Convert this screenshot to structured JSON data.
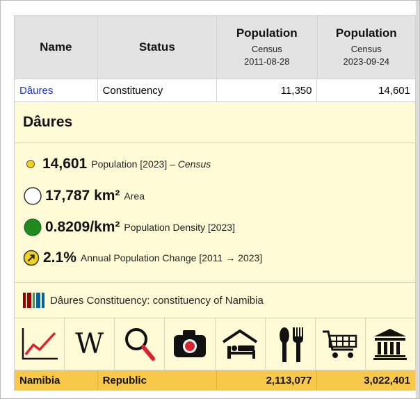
{
  "header": {
    "name": "Name",
    "status": "Status",
    "col3_title": "Population",
    "col3_sub1": "Census",
    "col3_sub2": "2011-08-28",
    "col4_title": "Population",
    "col4_sub1": "Census",
    "col4_sub2": "2023-09-24"
  },
  "row": {
    "name": "Dâures",
    "status": "Constituency",
    "pop2011": "11,350",
    "pop2023": "14,601"
  },
  "panel": {
    "title": "Dâures",
    "stats": [
      {
        "value": "14,601",
        "label": "Population [2023] –",
        "label_italic": "Census"
      },
      {
        "value": "17,787 km²",
        "label": "Area",
        "label_italic": ""
      },
      {
        "value": "0.8209/km²",
        "label": "Population Density [2023]",
        "label_italic": ""
      },
      {
        "value": "2.1%",
        "label": "Annual Population Change [2011 → 2023]",
        "label_italic": ""
      }
    ],
    "wikidata_text": "Dâures Constituency: constituency of Namibia",
    "icons": [
      "chart-line-icon",
      "wikipedia-icon",
      "search-icon",
      "camera-icon",
      "bed-icon",
      "restaurant-icon",
      "shopping-cart-icon",
      "museum-icon"
    ],
    "wikipedia_glyph": "W"
  },
  "footer": {
    "name": "Namibia",
    "status": "Republic",
    "pop2011": "2,113,077",
    "pop2023": "3,022,401"
  },
  "colors": {
    "link": "#1a33d6",
    "panel_bg": "#fefbd6",
    "header_bg": "#e3e3e3",
    "footer_bg": "#f7c84a",
    "icon_red": "#d9232e",
    "density_green": "#1f8a1f",
    "change_yellow": "#f2d21a"
  }
}
